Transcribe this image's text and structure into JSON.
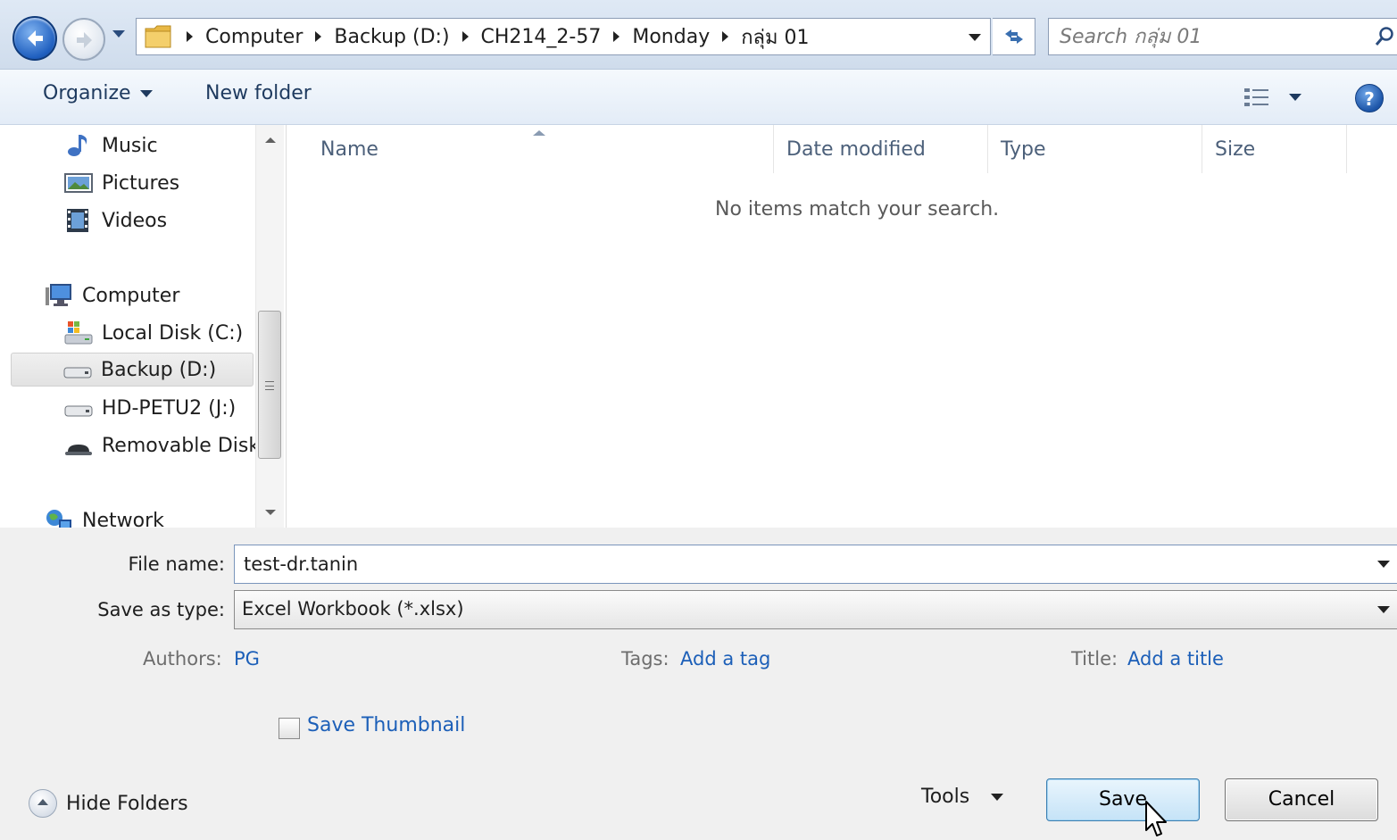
{
  "address": {
    "breadcrumbs": [
      "Computer",
      "Backup (D:)",
      "CH214_2-57",
      "Monday",
      "กลุ่ม 01"
    ]
  },
  "search": {
    "placeholder": "Search กลุ่ม 01"
  },
  "toolbar": {
    "organize_label": "Organize",
    "new_folder_label": "New folder"
  },
  "nav": {
    "items": [
      {
        "label": "Music",
        "icon": "music-icon"
      },
      {
        "label": "Pictures",
        "icon": "pictures-icon"
      },
      {
        "label": "Videos",
        "icon": "videos-icon"
      },
      {
        "label": "Computer",
        "icon": "computer-icon"
      },
      {
        "label": "Local Disk (C:)",
        "icon": "local-disk-icon"
      },
      {
        "label": "Backup (D:)",
        "icon": "drive-icon",
        "selected": true
      },
      {
        "label": "HD-PETU2 (J:)",
        "icon": "drive-icon"
      },
      {
        "label": "Removable Disk",
        "icon": "removable-disk-icon"
      },
      {
        "label": "Network",
        "icon": "network-icon"
      }
    ]
  },
  "file_list": {
    "columns": [
      "Name",
      "Date modified",
      "Type",
      "Size"
    ],
    "empty_message": "No items match your search."
  },
  "form": {
    "file_name_label": "File name:",
    "file_name_value": "test-dr.tanin",
    "save_type_label": "Save as type:",
    "save_type_value": "Excel Workbook (*.xlsx)",
    "authors_label": "Authors:",
    "authors_value": "PG",
    "tags_label": "Tags:",
    "tags_value": "Add a tag",
    "title_label": "Title:",
    "title_value": "Add a title",
    "thumbnail_label": "Save Thumbnail"
  },
  "footer": {
    "hide_folders_label": "Hide Folders",
    "tools_label": "Tools",
    "save_label": "Save",
    "cancel_label": "Cancel"
  },
  "colors": {
    "link": "#1c5fb8",
    "accent": "#3c7fb1"
  }
}
